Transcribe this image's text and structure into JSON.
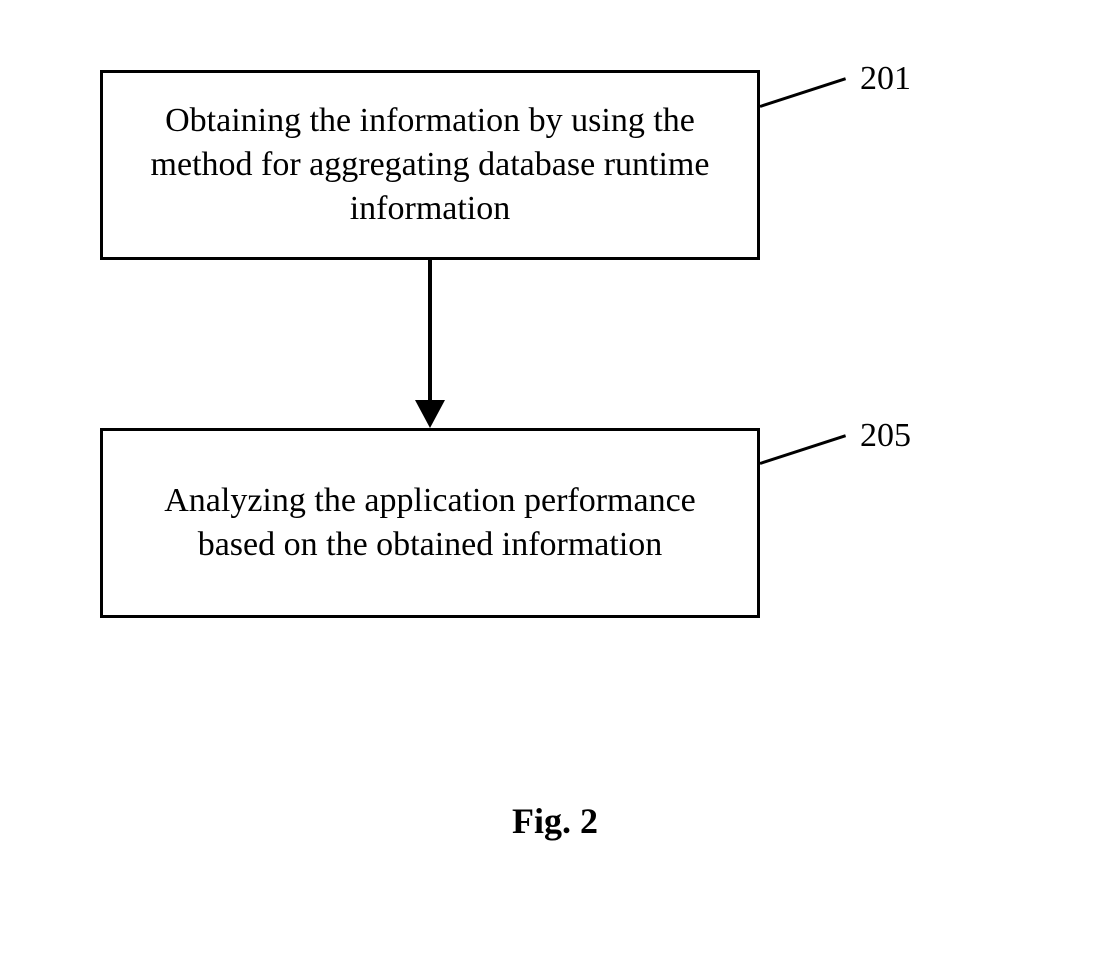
{
  "boxes": {
    "step1": {
      "text": "Obtaining the information by using the method for aggregating database runtime information",
      "label": "201"
    },
    "step2": {
      "text": "Analyzing the application performance based on the obtained information",
      "label": "205"
    }
  },
  "caption": "Fig. 2"
}
